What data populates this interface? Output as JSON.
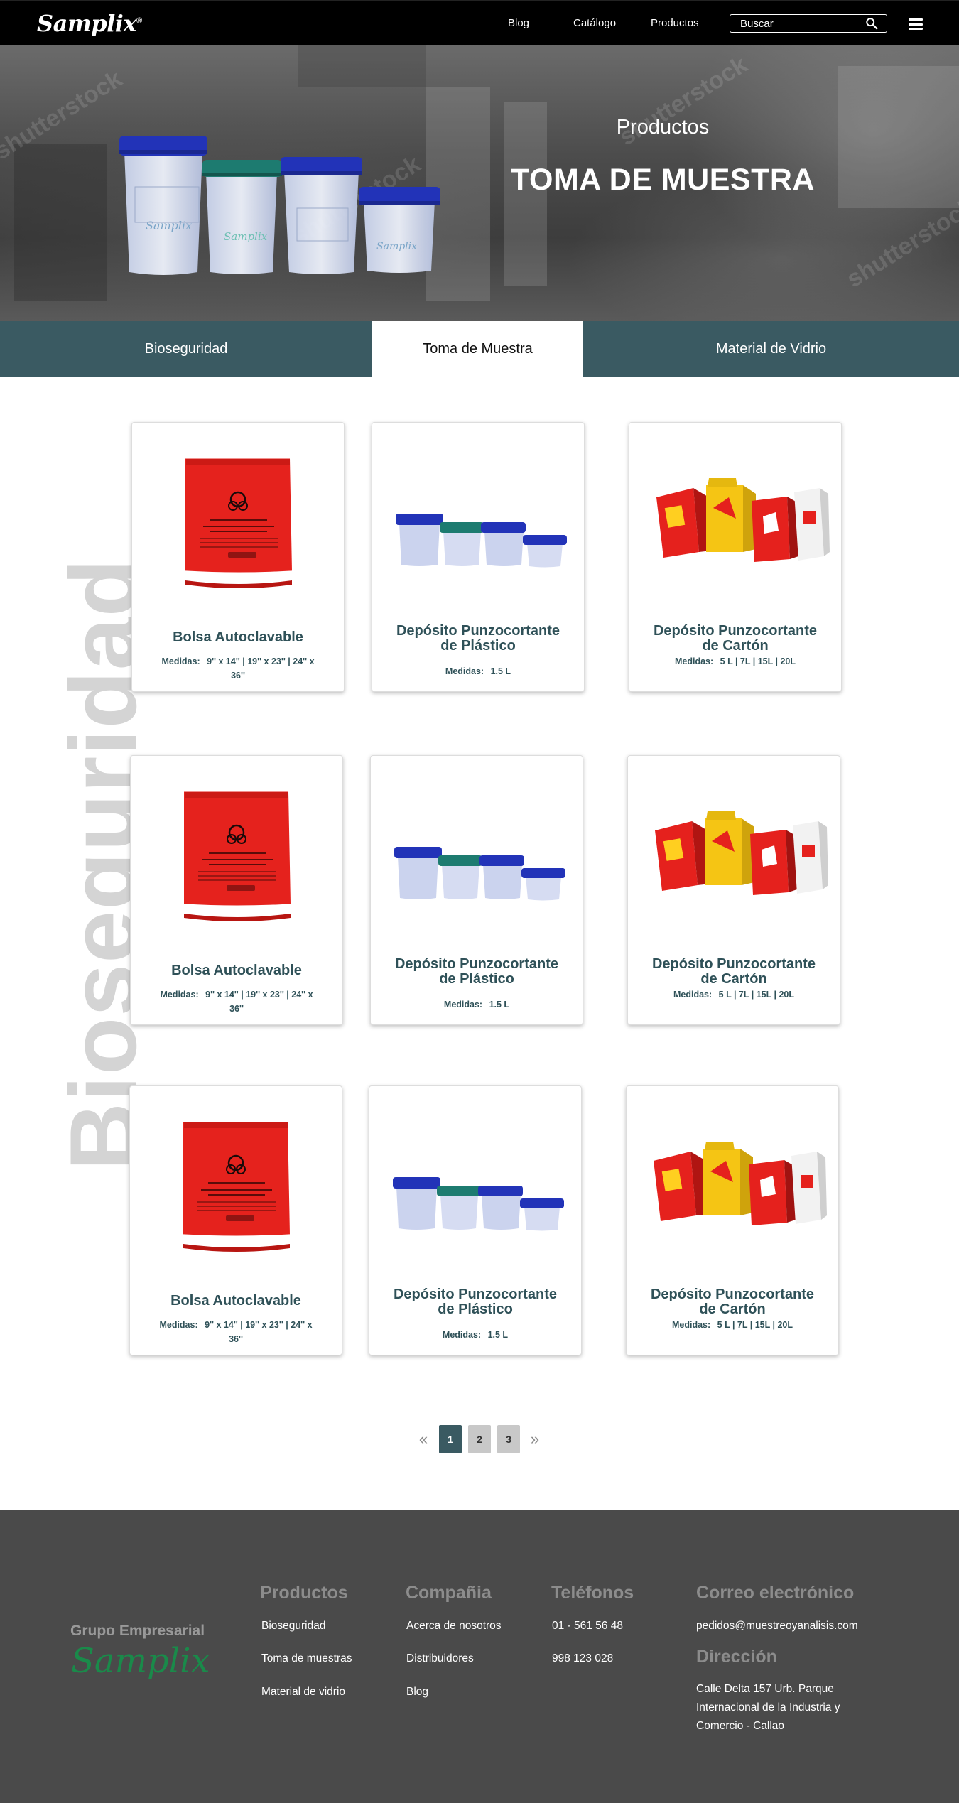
{
  "nav": {
    "logo": "Samplix",
    "logo_mark": "®",
    "links": [
      "Blog",
      "Catálogo",
      "Productos"
    ],
    "search_placeholder": "Buscar"
  },
  "hero": {
    "subtitle": "Productos",
    "title": "TOMA DE MUESTRA",
    "watermark": "shutterstock"
  },
  "tabs": [
    {
      "label": "Bioseguridad",
      "active": false
    },
    {
      "label": "Toma de Muestra",
      "active": true
    },
    {
      "label": "Material de Vidrio",
      "active": false
    }
  ],
  "side_label": "Bioseguridad",
  "measure_label": "Medidas:",
  "products": [
    {
      "name": "Bolsa Autoclavable",
      "measures": "9'' x 14'' | 19'' x 23'' | 24'' x 36''",
      "image": "red-biohazard-bag"
    },
    {
      "name": "Depósito Punzocortante de Plástico",
      "measures": "1.5 L",
      "image": "plastic-containers"
    },
    {
      "name": "Depósito Punzocortante de Cartón",
      "measures": "5 L  |  7L  |  15L  | 20L",
      "image": "cardboard-boxes"
    },
    {
      "name": "Bolsa Autoclavable",
      "measures": "9'' x 14'' | 19'' x 23'' | 24'' x 36''",
      "image": "red-biohazard-bag"
    },
    {
      "name": "Depósito Punzocortante de Plástico",
      "measures": "1.5 L",
      "image": "plastic-containers"
    },
    {
      "name": "Depósito Punzocortante de Cartón",
      "measures": "5 L  |  7L  |  15L  | 20L",
      "image": "cardboard-boxes"
    },
    {
      "name": "Bolsa Autoclavable",
      "measures": "9'' x 14'' | 19'' x 23'' | 24'' x 36''",
      "image": "red-biohazard-bag"
    },
    {
      "name": "Depósito Punzocortante de Plástico",
      "measures": "1.5 L",
      "image": "plastic-containers"
    },
    {
      "name": "Depósito Punzocortante de Cartón",
      "measures": "5 L  |  7L  |  15L  | 20L",
      "image": "cardboard-boxes"
    }
  ],
  "pagination": {
    "pages": [
      "1",
      "2",
      "3"
    ],
    "current": "1",
    "prev": "«",
    "next": "»"
  },
  "footer": {
    "brand": "Grupo Empresarial",
    "brand_script": "Samplix",
    "productos": {
      "heading": "Productos",
      "items": [
        "Bioseguridad",
        "Toma de muestras",
        "Material de vidrio"
      ]
    },
    "compania": {
      "heading": "Compañia",
      "items": [
        "Acerca de nosotros",
        "Distribuidores",
        "Blog"
      ]
    },
    "telefonos": {
      "heading": "Teléfonos",
      "items": [
        "01 - 561 56 48",
        "998 123 028"
      ]
    },
    "correo": {
      "heading": "Correo electrónico",
      "email": "pedidos@muestreoyanalisis.com"
    },
    "direccion": {
      "heading": "Dirección",
      "address": "Calle Delta 157 Urb. Parque Internacional de la Industria y Comercio - Callao"
    }
  },
  "colors": {
    "teal": "#3a5a62",
    "product_text": "#2f5158",
    "footer_bg": "#4a4a4a",
    "script_green": "#1a8a4a"
  }
}
